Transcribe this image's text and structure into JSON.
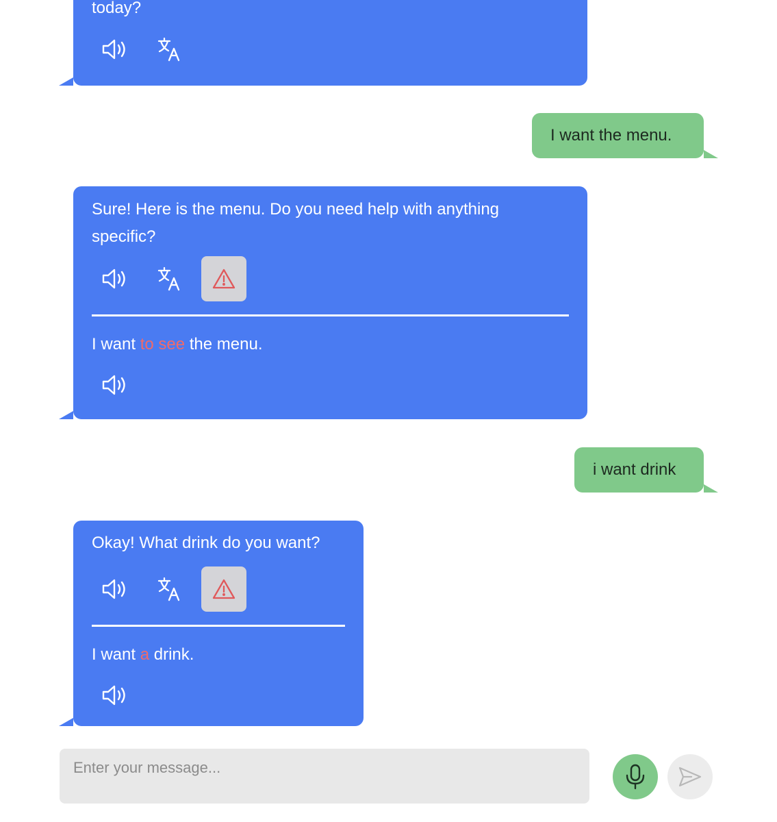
{
  "messages": [
    {
      "role": "bot",
      "text": "today?",
      "actions": [
        "speaker-icon",
        "translate-icon"
      ]
    },
    {
      "role": "user",
      "text": "I want the menu."
    },
    {
      "role": "bot",
      "text_line1": "Sure! Here is the menu. Do you need help with anything",
      "text_line2": "specific?",
      "actions": [
        "speaker-icon",
        "translate-icon",
        "warning-icon"
      ],
      "correction": {
        "before": "I want ",
        "highlight": "to see",
        "after": " the menu."
      }
    },
    {
      "role": "user",
      "text": "i want drink"
    },
    {
      "role": "bot",
      "text": "Okay! What drink do you want?",
      "actions": [
        "speaker-icon",
        "translate-icon",
        "warning-icon"
      ],
      "correction": {
        "before": "I want ",
        "highlight": "a",
        "after": " drink."
      }
    }
  ],
  "composer": {
    "placeholder": "Enter your message...",
    "mic_icon": "microphone-icon",
    "send_icon": "send-icon"
  },
  "colors": {
    "bot_bubble": "#4a7bf2",
    "user_bubble": "#80c98a",
    "error_highlight": "#f06a6a",
    "alert_button_bg": "#d4d4d8"
  }
}
